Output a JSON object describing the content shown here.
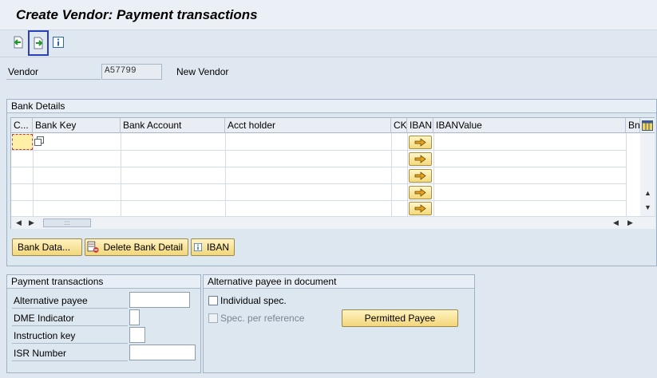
{
  "title": "Create Vendor: Payment transactions",
  "toolbar": {
    "buttons": [
      {
        "name": "previous-screen",
        "icon": "arrow-left-page-icon"
      },
      {
        "name": "next-screen",
        "icon": "arrow-right-page-icon"
      },
      {
        "name": "information",
        "icon": "info-icon"
      }
    ]
  },
  "vendor": {
    "label": "Vendor",
    "value": "A57799",
    "description": "New Vendor"
  },
  "bank_details": {
    "header": "Bank Details",
    "columns": [
      "C...",
      "Bank Key",
      "Bank Account",
      "Acct holder",
      "CK",
      "IBAN",
      "IBANValue",
      "Bn"
    ],
    "row_count": 5,
    "buttons": {
      "bank_data": "Bank Data...",
      "delete_bank_detail": "Delete Bank Detail",
      "iban": "IBAN"
    }
  },
  "payment_transactions": {
    "header": "Payment transactions",
    "fields": {
      "alternative_payee": "Alternative payee",
      "dme_indicator": "DME Indicator",
      "instruction_key": "Instruction key",
      "isr_number": "ISR Number"
    }
  },
  "alt_payee_doc": {
    "header": "Alternative payee in document",
    "individual_spec": "Individual spec.",
    "spec_per_reference": "Spec. per reference",
    "permitted_payee": "Permitted Payee"
  },
  "colors": {
    "background": "#dfe8f1",
    "button_yellow": "#f2d67a",
    "selection_border": "#2b3fb9",
    "required_cell": "#fff0a8"
  }
}
